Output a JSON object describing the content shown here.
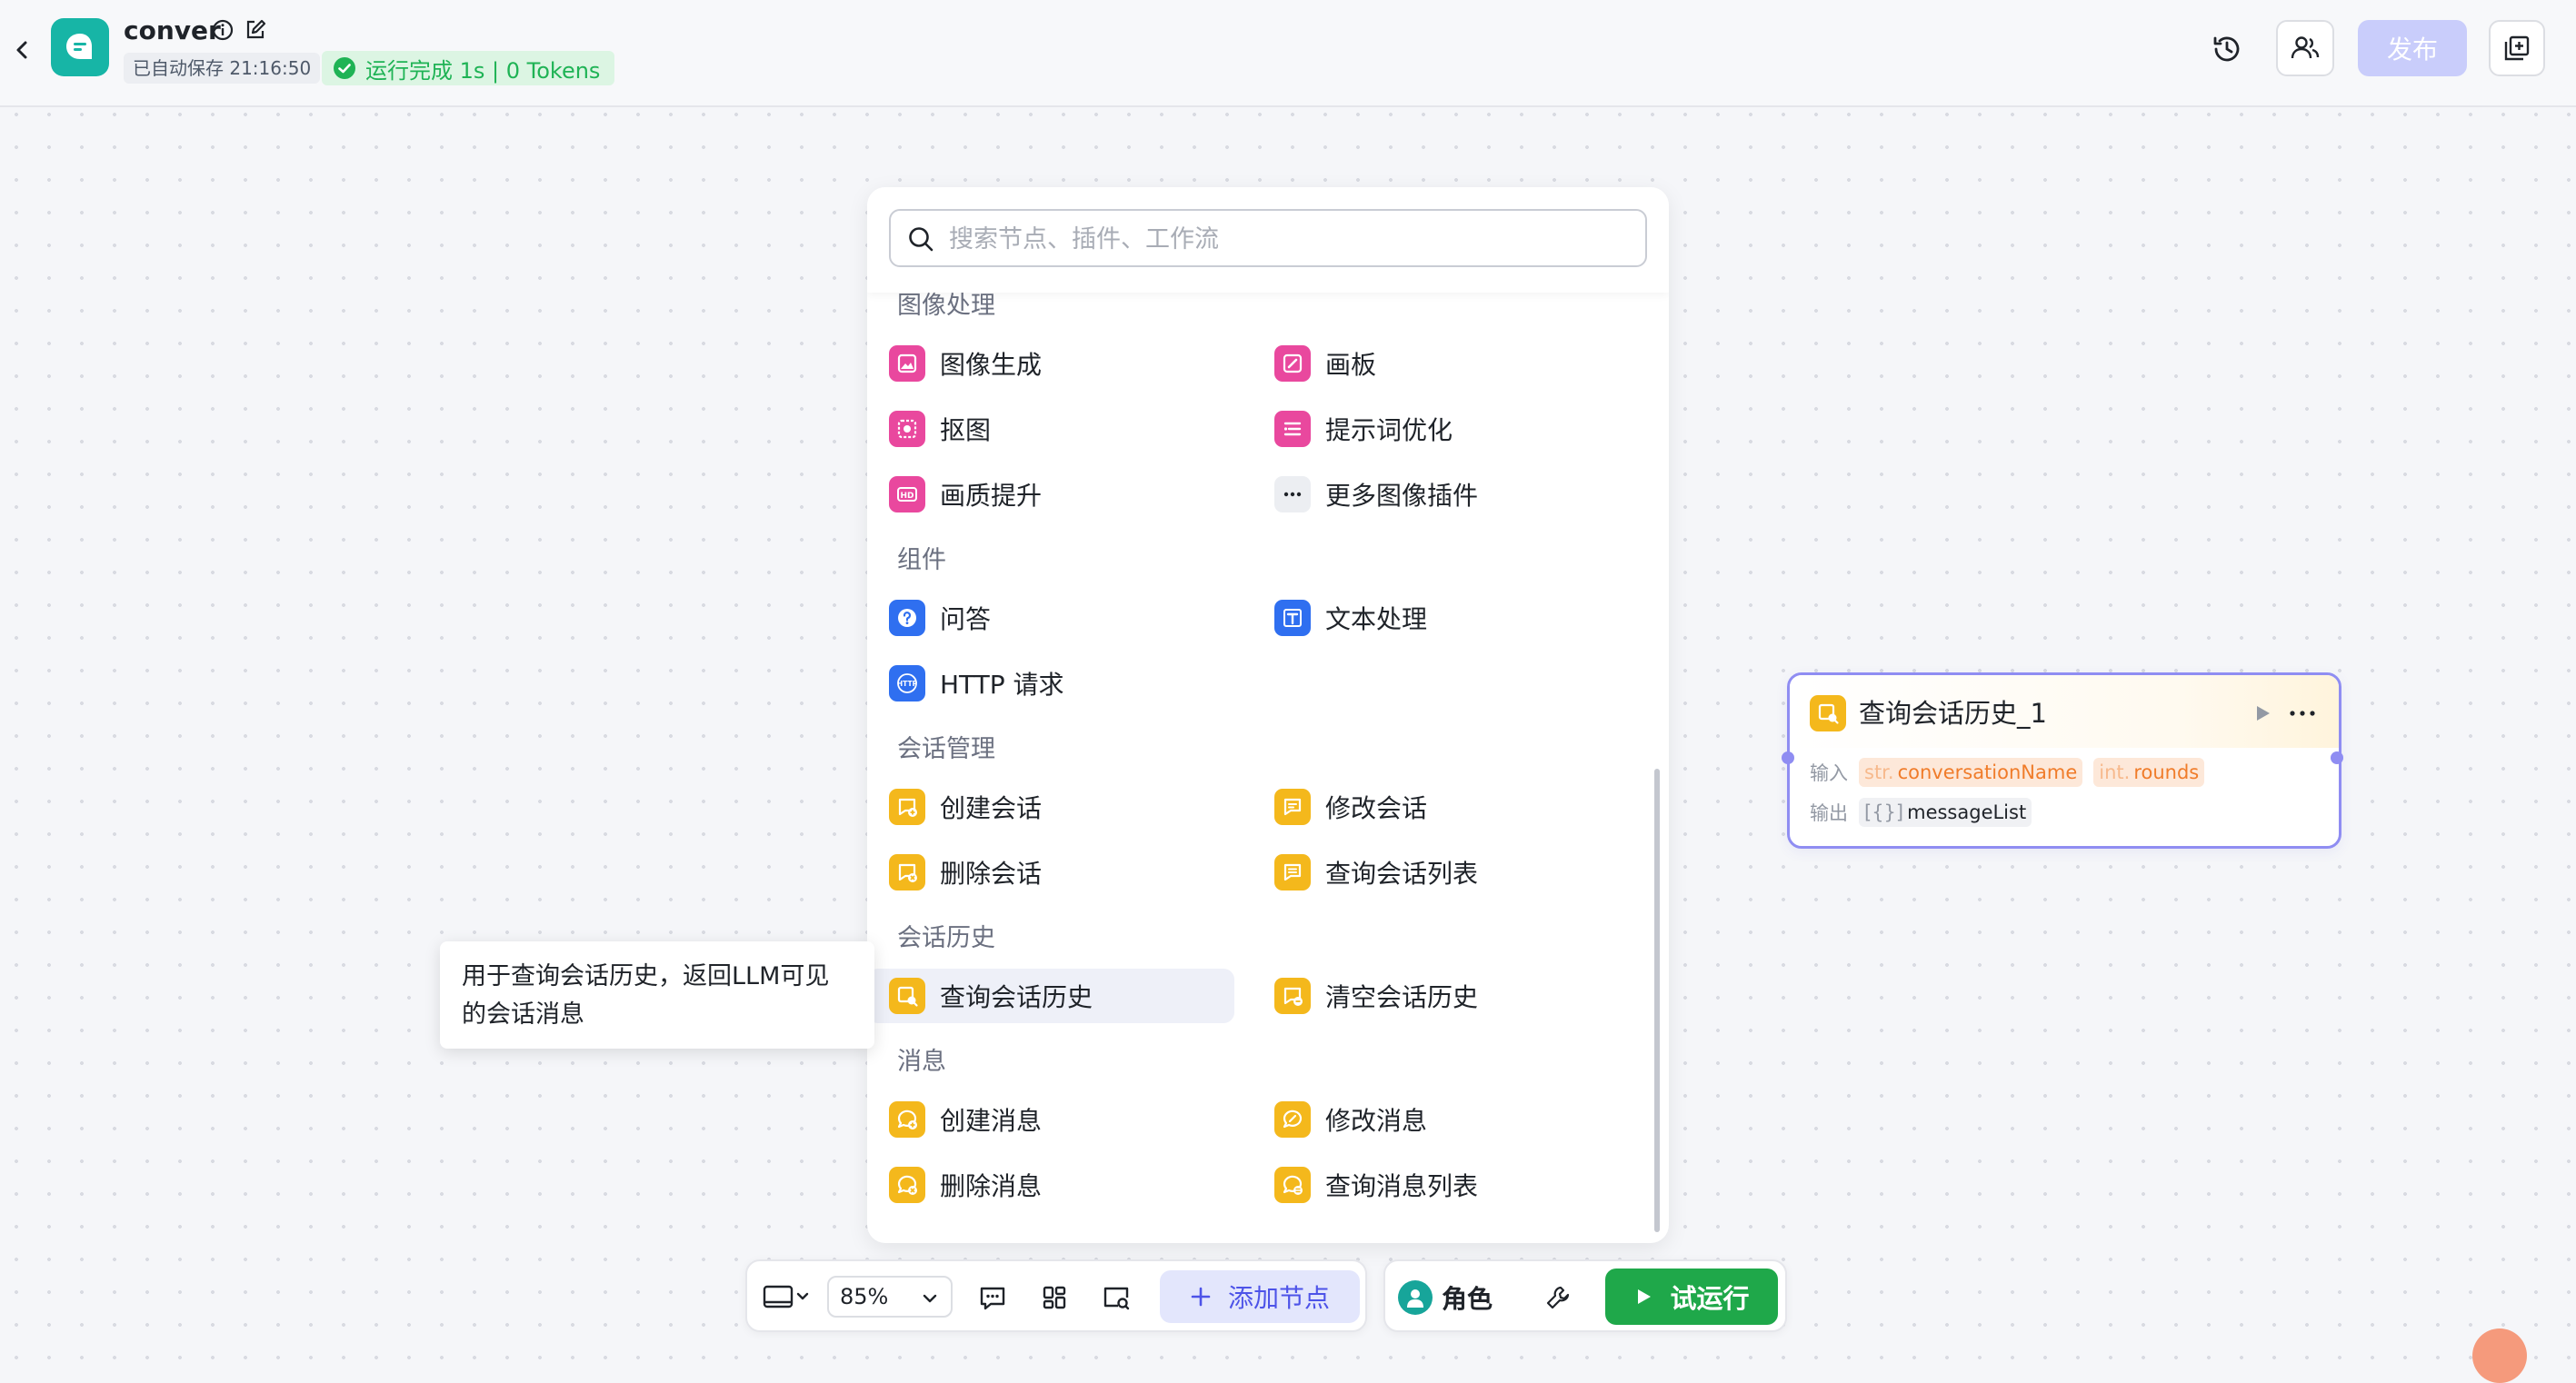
{
  "header": {
    "title": "conver",
    "autosave": "已自动保存 21:16:50",
    "run_status": "运行完成 1s | 0 Tokens",
    "publish_label": "发布"
  },
  "panel": {
    "search_placeholder": "搜索节点、插件、工作流",
    "categories": [
      {
        "title": "图像处理",
        "items": [
          {
            "label": "图像生成",
            "icon": "image-generate-icon",
            "color": "pink"
          },
          {
            "label": "画板",
            "icon": "canvas-board-icon",
            "color": "pink"
          },
          {
            "label": "抠图",
            "icon": "cutout-icon",
            "color": "pink"
          },
          {
            "label": "提示词优化",
            "icon": "prompt-optimize-icon",
            "color": "pink"
          },
          {
            "label": "画质提升",
            "icon": "hd-enhance-icon",
            "color": "pink"
          },
          {
            "label": "更多图像插件",
            "icon": "more-dots-icon",
            "color": "gray"
          }
        ]
      },
      {
        "title": "组件",
        "items": [
          {
            "label": "问答",
            "icon": "question-icon",
            "color": "blue"
          },
          {
            "label": "文本处理",
            "icon": "text-process-icon",
            "color": "blue"
          },
          {
            "label": "HTTP 请求",
            "icon": "http-icon",
            "color": "blue"
          }
        ]
      },
      {
        "title": "会话管理",
        "items": [
          {
            "label": "创建会话",
            "icon": "create-conversation-icon",
            "color": "yellow"
          },
          {
            "label": "修改会话",
            "icon": "edit-conversation-icon",
            "color": "yellow"
          },
          {
            "label": "删除会话",
            "icon": "delete-conversation-icon",
            "color": "yellow"
          },
          {
            "label": "查询会话列表",
            "icon": "list-conversation-icon",
            "color": "yellow"
          }
        ]
      },
      {
        "title": "会话历史",
        "items": [
          {
            "label": "查询会话历史",
            "icon": "query-history-icon",
            "color": "yellow"
          },
          {
            "label": "清空会话历史",
            "icon": "clear-history-icon",
            "color": "yellow"
          }
        ]
      },
      {
        "title": "消息",
        "items": [
          {
            "label": "创建消息",
            "icon": "create-message-icon",
            "color": "yellow"
          },
          {
            "label": "修改消息",
            "icon": "edit-message-icon",
            "color": "yellow"
          },
          {
            "label": "删除消息",
            "icon": "delete-message-icon",
            "color": "yellow"
          },
          {
            "label": "查询消息列表",
            "icon": "list-message-icon",
            "color": "yellow"
          }
        ]
      }
    ]
  },
  "tooltip": {
    "text": "用于查询会话历史，返回LLM可见的会话消息"
  },
  "node": {
    "title": "查询会话历史_1",
    "input_label": "输入",
    "output_label": "输出",
    "inputs": [
      {
        "type": "str.",
        "name": "conversationName"
      },
      {
        "type": "int.",
        "name": "rounds"
      }
    ],
    "outputs": [
      {
        "type": "[{}]",
        "name": "messageList"
      }
    ]
  },
  "toolbar": {
    "zoom": "85%",
    "add_node_label": "添加节点",
    "role_label": "角色",
    "run_label": "试运行"
  },
  "colors": {
    "accent": "#4d53e8",
    "publish_disabled": "#c9cdfb",
    "run_green": "#1fa84a",
    "node_border": "#8f8df2",
    "plugin_pink": "#e9489e",
    "plugin_blue": "#2f6ff0",
    "plugin_yellow": "#f4b81c"
  }
}
